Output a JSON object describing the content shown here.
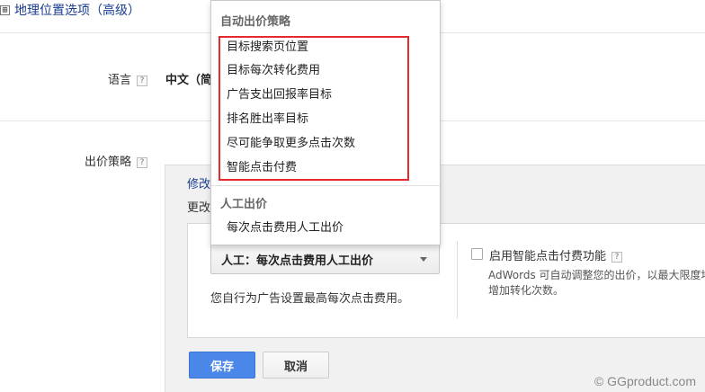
{
  "geo": {
    "expand": "⊞",
    "link": "地理位置选项（高级）"
  },
  "language": {
    "label": "语言",
    "help": "?",
    "value": "中文（简"
  },
  "bid_strategy": {
    "label": "出价策略",
    "help": "?",
    "modify_link": "修改",
    "change_text": "更改",
    "selected": "人工：每次点击费用人工出价",
    "manual_description": "您自行为广告设置最高每次点击费用。",
    "ecpc_label": "启用智能点击付费功能",
    "ecpc_help": "?",
    "ecpc_description": "AdWords 可自动调整您的出价，以最大限度地增加转化次数。"
  },
  "dropdown": {
    "auto_header": "自动出价策略",
    "auto_options": [
      "目标搜索页位置",
      "目标每次转化费用",
      "广告支出回报率目标",
      "排名胜出率目标",
      "尽可能争取更多点击次数",
      "智能点击付费"
    ],
    "manual_header": "人工出价",
    "manual_options": [
      "每次点击费用人工出价"
    ]
  },
  "buttons": {
    "save": "保存",
    "cancel": "取消"
  },
  "watermark": "© GGproduct.com",
  "colors": {
    "primary_button": "#4b87e8",
    "highlight_border": "#e42a2a",
    "link": "#1a3d8f"
  }
}
